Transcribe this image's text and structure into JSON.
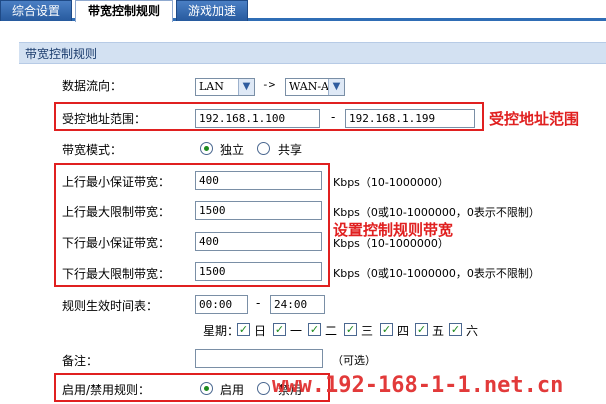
{
  "tabs": [
    {
      "label": "综合设置"
    },
    {
      "label": "带宽控制规则"
    },
    {
      "label": "游戏加速"
    }
  ],
  "panel": {
    "title": "带宽控制规则"
  },
  "data_flow": {
    "label": "数据流向：",
    "from": "LAN",
    "arrow": "->",
    "to": "WAN-AL"
  },
  "address": {
    "label": "受控地址范围：",
    "start": "192.168.1.100",
    "dash": "-",
    "end": "192.168.1.199"
  },
  "mode": {
    "label": "带宽模式：",
    "option1": "独立",
    "option2": "共享",
    "selected": "独立"
  },
  "bandwidth": {
    "up_min": {
      "label": "上行最小保证带宽：",
      "value": "400",
      "unit": "Kbps（10-1000000）"
    },
    "up_max": {
      "label": "上行最大限制带宽：",
      "value": "1500",
      "unit": "Kbps（0或10-1000000，0表示不限制）"
    },
    "down_min": {
      "label": "下行最小保证带宽：",
      "value": "400",
      "unit": "Kbps（10-1000000）"
    },
    "down_max": {
      "label": "下行最大限制带宽：",
      "value": "1500",
      "unit": "Kbps（0或10-1000000，0表示不限制）"
    }
  },
  "schedule": {
    "label": "规则生效时间表：",
    "start": "00:00",
    "dash": "-",
    "end": "24:00"
  },
  "week": {
    "label": "星期：",
    "days": [
      "日",
      "一",
      "二",
      "三",
      "四",
      "五",
      "六"
    ],
    "checked": [
      true,
      true,
      true,
      true,
      true,
      true,
      true
    ]
  },
  "remark": {
    "label": "备注：",
    "value": "",
    "hint": "（可选）"
  },
  "enable": {
    "label": "启用/禁用规则：",
    "option1": "启用",
    "option2": "禁用",
    "selected": "启用"
  },
  "annotations": {
    "address": "受控地址范围",
    "bandwidth": "设置控制规则带宽"
  },
  "watermark": "www.192-168-1-1.net.cn",
  "colors": {
    "accent": "#2f6db5",
    "annotation": "#e02020",
    "check": "#1d8a1d"
  }
}
